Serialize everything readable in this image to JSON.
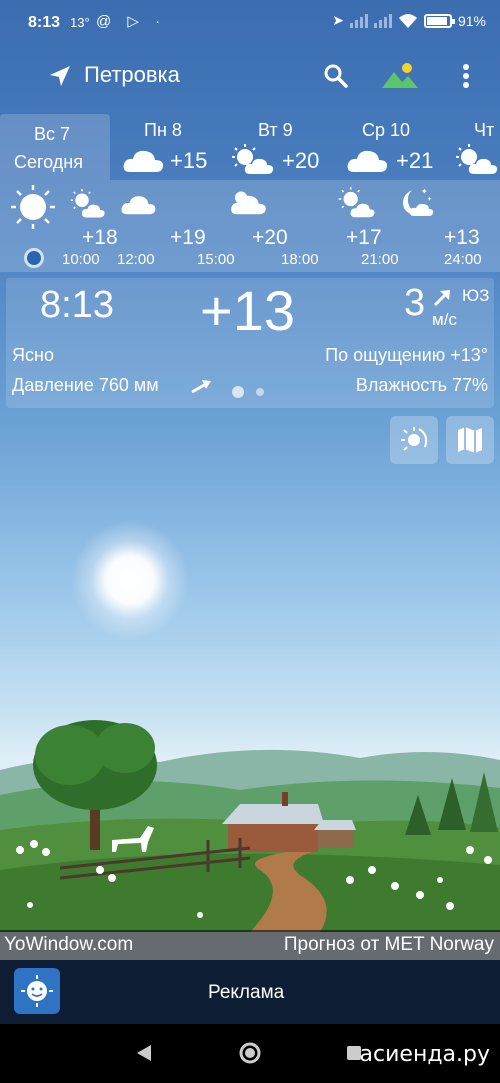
{
  "status_bar": {
    "time": "8:13",
    "temp_small": "13°",
    "battery": "91%"
  },
  "app_bar": {
    "city": "Петровка"
  },
  "day_tabs": [
    {
      "day": "Вс 7",
      "sub": "Сегодня",
      "temp": ""
    },
    {
      "day": "Пн 8",
      "sub": "",
      "temp": "+15"
    },
    {
      "day": "Вт 9",
      "sub": "",
      "temp": "+20"
    },
    {
      "day": "Ср 10",
      "sub": "",
      "temp": "+21"
    },
    {
      "day": "Чт",
      "sub": "",
      "temp": ""
    }
  ],
  "hourly": {
    "temps": [
      "+18",
      "+19",
      "+20",
      "+17",
      "+13"
    ],
    "times": [
      "10:00",
      "12:00",
      "15:00",
      "18:00",
      "21:00",
      "24:00"
    ]
  },
  "current": {
    "time": "8:13",
    "temp": "+13",
    "wind_speed": "3",
    "wind_dir": "ЮЗ",
    "wind_unit": "м/с",
    "condition": "Ясно",
    "feels_like": "По ощущению +13°",
    "pressure": "Давление 760 мм",
    "humidity": "Влажность 77%"
  },
  "footer": {
    "left": "YoWindow.com",
    "right": "Прогноз от MET Norway"
  },
  "ad": {
    "label": "Реклама"
  },
  "watermark": "асиенда.ру",
  "colors": {
    "sky_top": "#3b6db0",
    "ad_bar": "#0d1d33",
    "app_icon": "#2f73c4"
  },
  "icons": [
    "location-arrow-icon",
    "search-icon",
    "landscape-icon",
    "more-vert-icon",
    "sun-cloud-icon",
    "cloud-icon",
    "moon-icon",
    "map-icon"
  ]
}
